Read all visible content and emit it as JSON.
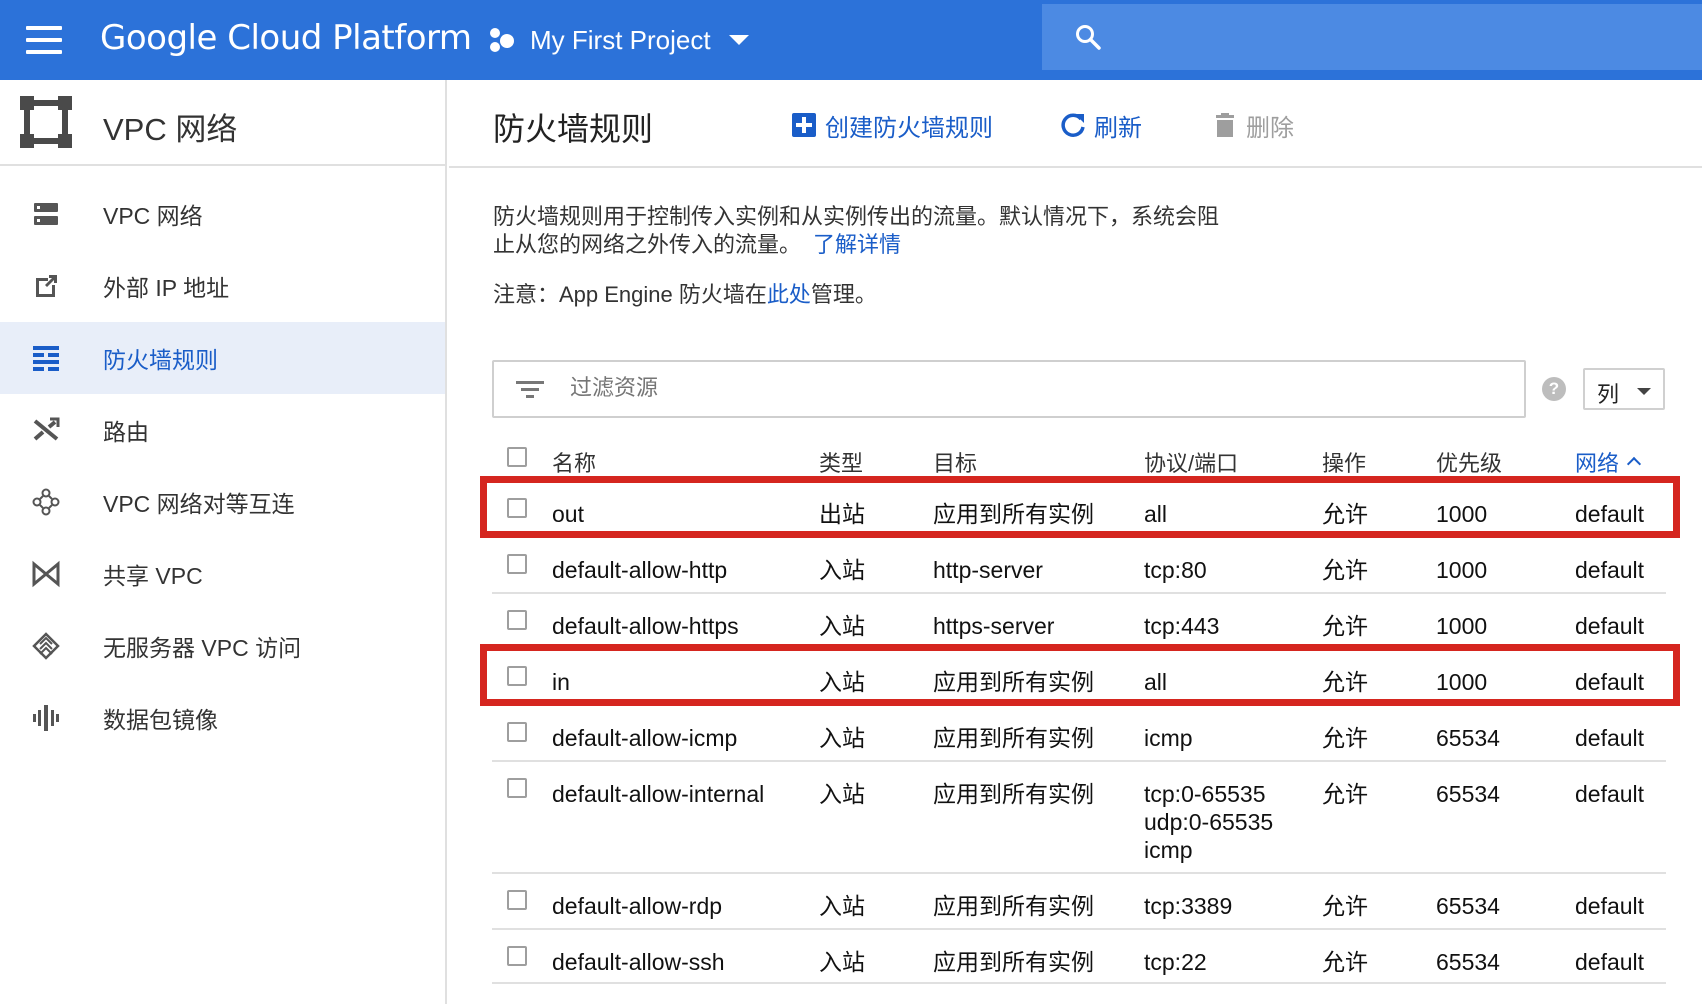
{
  "topbar": {
    "brand": "Google Cloud Platform",
    "project": "My First Project"
  },
  "sidebar": {
    "title": "VPC 网络",
    "items": [
      {
        "label": "VPC 网络",
        "icon": "vpc-network-icon",
        "active": false
      },
      {
        "label": "外部 IP 地址",
        "icon": "external-ip-icon",
        "active": false
      },
      {
        "label": "防火墙规则",
        "icon": "firewall-icon",
        "active": true
      },
      {
        "label": "路由",
        "icon": "routes-icon",
        "active": false
      },
      {
        "label": "VPC 网络对等互连",
        "icon": "peering-icon",
        "active": false
      },
      {
        "label": "共享 VPC",
        "icon": "shared-vpc-icon",
        "active": false
      },
      {
        "label": "无服务器 VPC 访问",
        "icon": "serverless-icon",
        "active": false
      },
      {
        "label": "数据包镜像",
        "icon": "packet-mirroring-icon",
        "active": false
      }
    ]
  },
  "header": {
    "title": "防火墙规则",
    "create_label": "创建防火墙规则",
    "refresh_label": "刷新",
    "delete_label": "删除"
  },
  "description": {
    "line1": "防火墙规则用于控制传入实例和从实例传出的流量。默认情况下，系统会阻",
    "line2": "止从您的网络之外传入的流量。",
    "learn_more": "了解详情",
    "note_prefix": "注意：App Engine 防火墙在",
    "note_link": "此处",
    "note_suffix": "管理。"
  },
  "filter": {
    "placeholder": "过滤资源",
    "help": "?",
    "columns_label": "列"
  },
  "table": {
    "headers": {
      "name": "名称",
      "type": "类型",
      "target": "目标",
      "protocol": "协议/端口",
      "action": "操作",
      "priority": "优先级",
      "network": "网络"
    },
    "rows": [
      {
        "name": "out",
        "type": "出站",
        "target": "应用到所有实例",
        "protocol": "all",
        "action": "允许",
        "priority": "1000",
        "network": "default",
        "highlighted": true
      },
      {
        "name": "default-allow-http",
        "type": "入站",
        "target": "http-server",
        "protocol": "tcp:80",
        "action": "允许",
        "priority": "1000",
        "network": "default",
        "highlighted": false
      },
      {
        "name": "default-allow-https",
        "type": "入站",
        "target": "https-server",
        "protocol": "tcp:443",
        "action": "允许",
        "priority": "1000",
        "network": "default",
        "highlighted": false
      },
      {
        "name": "in",
        "type": "入站",
        "target": "应用到所有实例",
        "protocol": "all",
        "action": "允许",
        "priority": "1000",
        "network": "default",
        "highlighted": true
      },
      {
        "name": "default-allow-icmp",
        "type": "入站",
        "target": "应用到所有实例",
        "protocol": "icmp",
        "action": "允许",
        "priority": "65534",
        "network": "default",
        "highlighted": false
      },
      {
        "name": "default-allow-internal",
        "type": "入站",
        "target": "应用到所有实例",
        "protocol": "tcp:0-65535\nudp:0-65535\nicmp",
        "action": "允许",
        "priority": "65534",
        "network": "default",
        "highlighted": false
      },
      {
        "name": "default-allow-rdp",
        "type": "入站",
        "target": "应用到所有实例",
        "protocol": "tcp:3389",
        "action": "允许",
        "priority": "65534",
        "network": "default",
        "highlighted": false
      },
      {
        "name": "default-allow-ssh",
        "type": "入站",
        "target": "应用到所有实例",
        "protocol": "tcp:22",
        "action": "允许",
        "priority": "65534",
        "network": "default",
        "highlighted": false
      }
    ]
  },
  "colors": {
    "topbar": "#2c72d9",
    "accent": "#1a5dc8",
    "highlight": "#d5261f"
  }
}
